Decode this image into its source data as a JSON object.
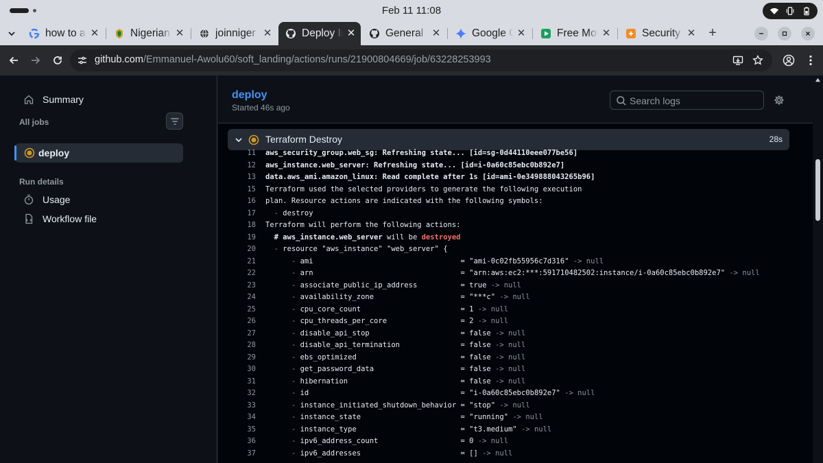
{
  "os": {
    "clock": "Feb 11  11:08"
  },
  "browser": {
    "tabs": [
      {
        "label": "how to a",
        "icon": "google-icon"
      },
      {
        "label": "Nigerian",
        "icon": "nigeria-crest-icon"
      },
      {
        "label": "joinniger",
        "icon": "globe-icon"
      },
      {
        "label": "Deploy In",
        "icon": "github-icon",
        "active": true
      },
      {
        "label": "General",
        "icon": "github-icon"
      },
      {
        "label": "Google G",
        "icon": "gemini-icon"
      },
      {
        "label": "Free Mov",
        "icon": "play-icon"
      },
      {
        "label": "Security",
        "icon": "security-icon"
      }
    ],
    "url_host": "github.com",
    "url_path": "/Emmanuel-Awolu60/soft_landing/actions/runs/21900804669/job/63228253993"
  },
  "sidebar": {
    "summary_label": "Summary",
    "all_jobs_heading": "All jobs",
    "active_job": "deploy",
    "run_details_heading": "Run details",
    "usage_label": "Usage",
    "workflow_label": "Workflow file"
  },
  "job": {
    "title": "deploy",
    "started": "Started 46s ago",
    "search_placeholder": "Search logs"
  },
  "step": {
    "name": "Terraform Destroy",
    "duration": "28s"
  },
  "log_lines": [
    {
      "n": "11",
      "bold": true,
      "segments": [
        {
          "t": "aws_security_group.web_sg: Refreshing state... [id=sg-0d44110eee077be56]"
        }
      ]
    },
    {
      "n": "12",
      "bold": true,
      "segments": [
        {
          "t": "aws_instance.web_server: Refreshing state... [id=i-0a60c85ebc0b892e7]"
        }
      ]
    },
    {
      "n": "13",
      "bold": true,
      "segments": [
        {
          "t": "data.aws_ami.amazon_linux: Read complete after 1s [id=ami-0e349888043265b96]"
        }
      ]
    },
    {
      "n": "15",
      "segments": [
        {
          "t": "Terraform used the selected providers to generate the following execution"
        }
      ]
    },
    {
      "n": "16",
      "segments": [
        {
          "t": "plan. Resource actions are indicated with the following symbols:"
        }
      ]
    },
    {
      "n": "17",
      "segments": [
        {
          "t": "  "
        },
        {
          "t": "-",
          "c": "del"
        },
        {
          "t": " destroy"
        }
      ]
    },
    {
      "n": "18",
      "segments": [
        {
          "t": "Terraform will perform the following actions:"
        }
      ]
    },
    {
      "n": "19",
      "segments": [
        {
          "t": "  # aws_instance.web_server",
          "c": "bold"
        },
        {
          "t": " will be "
        },
        {
          "t": "destroyed",
          "c": "red"
        }
      ]
    },
    {
      "n": "20",
      "segments": [
        {
          "t": "  "
        },
        {
          "t": "-",
          "c": "del"
        },
        {
          "t": " resource \"aws_instance\" \"web_server\" {"
        }
      ]
    },
    {
      "n": "21",
      "segments": [
        {
          "t": "      "
        },
        {
          "t": "-",
          "c": "del"
        },
        {
          "t": " ami                                  = \"ami-0c02fb55956c7d316\" "
        },
        {
          "t": "-> null",
          "c": "dim"
        }
      ]
    },
    {
      "n": "22",
      "segments": [
        {
          "t": "      "
        },
        {
          "t": "-",
          "c": "del"
        },
        {
          "t": " arn                                  = \"arn:aws:ec2:***:591710482502:instance/i-0a60c85ebc0b892e7\" "
        },
        {
          "t": "-> null",
          "c": "dim"
        }
      ]
    },
    {
      "n": "23",
      "segments": [
        {
          "t": "      "
        },
        {
          "t": "-",
          "c": "del"
        },
        {
          "t": " associate_public_ip_address          = true "
        },
        {
          "t": "-> null",
          "c": "dim"
        }
      ]
    },
    {
      "n": "24",
      "segments": [
        {
          "t": "      "
        },
        {
          "t": "-",
          "c": "del"
        },
        {
          "t": " availability_zone                    = \"***c\" "
        },
        {
          "t": "-> null",
          "c": "dim"
        }
      ]
    },
    {
      "n": "25",
      "segments": [
        {
          "t": "      "
        },
        {
          "t": "-",
          "c": "del"
        },
        {
          "t": " cpu_core_count                       = 1 "
        },
        {
          "t": "-> null",
          "c": "dim"
        }
      ]
    },
    {
      "n": "26",
      "segments": [
        {
          "t": "      "
        },
        {
          "t": "-",
          "c": "del"
        },
        {
          "t": " cpu_threads_per_core                 = 2 "
        },
        {
          "t": "-> null",
          "c": "dim"
        }
      ]
    },
    {
      "n": "27",
      "segments": [
        {
          "t": "      "
        },
        {
          "t": "-",
          "c": "del"
        },
        {
          "t": " disable_api_stop                     = false "
        },
        {
          "t": "-> null",
          "c": "dim"
        }
      ]
    },
    {
      "n": "28",
      "segments": [
        {
          "t": "      "
        },
        {
          "t": "-",
          "c": "del"
        },
        {
          "t": " disable_api_termination              = false "
        },
        {
          "t": "-> null",
          "c": "dim"
        }
      ]
    },
    {
      "n": "29",
      "segments": [
        {
          "t": "      "
        },
        {
          "t": "-",
          "c": "del"
        },
        {
          "t": " ebs_optimized                        = false "
        },
        {
          "t": "-> null",
          "c": "dim"
        }
      ]
    },
    {
      "n": "30",
      "segments": [
        {
          "t": "      "
        },
        {
          "t": "-",
          "c": "del"
        },
        {
          "t": " get_password_data                    = false "
        },
        {
          "t": "-> null",
          "c": "dim"
        }
      ]
    },
    {
      "n": "31",
      "segments": [
        {
          "t": "      "
        },
        {
          "t": "-",
          "c": "del"
        },
        {
          "t": " hibernation                          = false "
        },
        {
          "t": "-> null",
          "c": "dim"
        }
      ]
    },
    {
      "n": "32",
      "segments": [
        {
          "t": "      "
        },
        {
          "t": "-",
          "c": "del"
        },
        {
          "t": " id                                   = \"i-0a60c85ebc0b892e7\" "
        },
        {
          "t": "-> null",
          "c": "dim"
        }
      ]
    },
    {
      "n": "33",
      "segments": [
        {
          "t": "      "
        },
        {
          "t": "-",
          "c": "del"
        },
        {
          "t": " instance_initiated_shutdown_behavior = \"stop\" "
        },
        {
          "t": "-> null",
          "c": "dim"
        }
      ]
    },
    {
      "n": "34",
      "segments": [
        {
          "t": "      "
        },
        {
          "t": "-",
          "c": "del"
        },
        {
          "t": " instance_state                       = \"running\" "
        },
        {
          "t": "-> null",
          "c": "dim"
        }
      ]
    },
    {
      "n": "35",
      "segments": [
        {
          "t": "      "
        },
        {
          "t": "-",
          "c": "del"
        },
        {
          "t": " instance_type                        = \"t3.medium\" "
        },
        {
          "t": "-> null",
          "c": "dim"
        }
      ]
    },
    {
      "n": "36",
      "segments": [
        {
          "t": "      "
        },
        {
          "t": "-",
          "c": "del"
        },
        {
          "t": " ipv6_address_count                   = 0 "
        },
        {
          "t": "-> null",
          "c": "dim"
        }
      ]
    },
    {
      "n": "37",
      "segments": [
        {
          "t": "      "
        },
        {
          "t": "-",
          "c": "del"
        },
        {
          "t": " ipv6_addresses                       = [] "
        },
        {
          "t": "-> null",
          "c": "dim"
        }
      ]
    }
  ],
  "colors": {
    "accent": "#4493f8",
    "status_in_progress": "#d29922",
    "destroy": "#f47067"
  }
}
